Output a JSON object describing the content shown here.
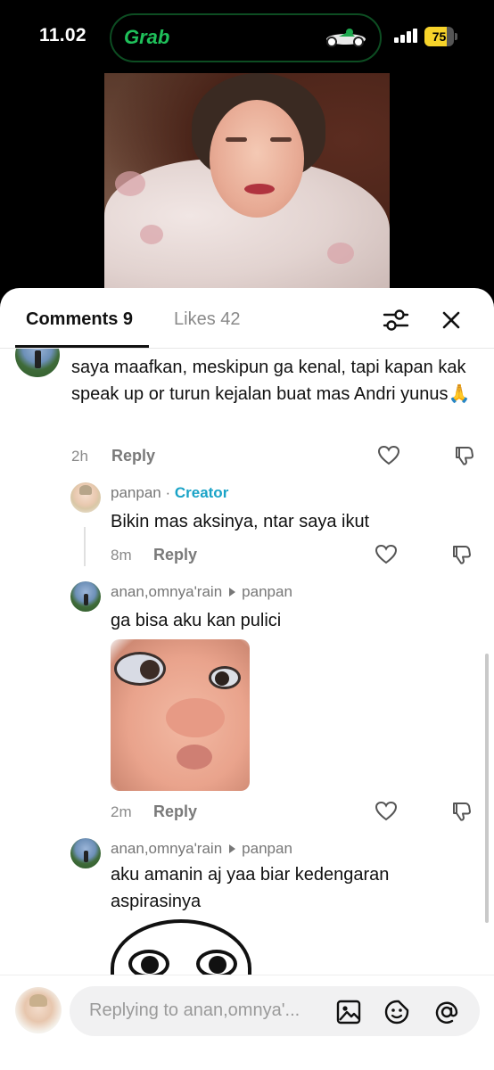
{
  "status_bar": {
    "time": "11.02",
    "live_activity_app": "Grab",
    "battery_percent": "75",
    "battery_level": 0.75,
    "accent_color": "#1fc05a"
  },
  "sheet": {
    "tabs": [
      {
        "label": "Comments 9",
        "active": true
      },
      {
        "label": "Likes 42",
        "active": false
      }
    ],
    "icons": {
      "filter": "sliders-icon",
      "close": "close-icon"
    }
  },
  "comments": [
    {
      "text": "saya maafkan, meskipun ga kenal, tapi kapan kak speak up or turun kejalan buat mas Andri yunus🙏",
      "time": "2h",
      "reply_label": "Reply"
    },
    {
      "username": "panpan",
      "separator": " · ",
      "badge": "Creator",
      "text": "Bikin mas aksinya, ntar saya ikut",
      "time": "8m",
      "reply_label": "Reply"
    },
    {
      "username": "anan,omnya'rain",
      "reply_to": "panpan",
      "text": "ga bisa aku kan pulici",
      "has_sticker": true,
      "time": "2m",
      "reply_label": "Reply"
    },
    {
      "username": "anan,omnya'rain",
      "reply_to": "panpan",
      "text": "aku amanin aj yaa biar kedengaran aspirasinya",
      "has_sticker": true
    }
  ],
  "reply_bar": {
    "placeholder": "Replying to anan,omnya'...",
    "icons": [
      "image-icon",
      "sticker-icon",
      "mention-icon"
    ]
  }
}
